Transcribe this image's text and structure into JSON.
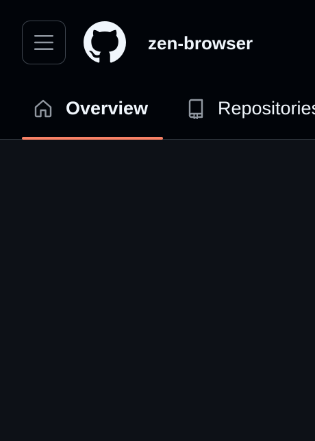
{
  "header": {
    "org_name": "zen-browser",
    "menu_icon": "hamburger-menu-icon",
    "logo_icon": "github-logo-icon"
  },
  "tabs": [
    {
      "label": "Overview",
      "icon": "home-icon",
      "selected": true
    },
    {
      "label": "Repositories",
      "icon": "repo-icon",
      "selected": false
    }
  ],
  "colors": {
    "header_bg": "#010409",
    "page_bg": "#0d1117",
    "text": "#f0f6fc",
    "icon_muted": "#9198a1",
    "border": "#30363d",
    "selected_underline": "#f78166"
  }
}
